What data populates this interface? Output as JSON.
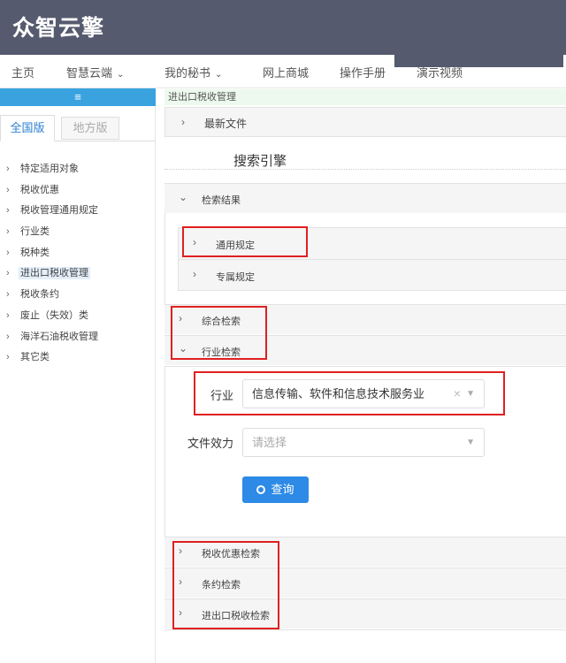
{
  "header": {
    "logo": "众智云擎"
  },
  "nav": {
    "items": [
      {
        "label": "主页",
        "has_caret": false
      },
      {
        "label": "智慧云端",
        "has_caret": true
      },
      {
        "label": "我的秘书",
        "has_caret": true
      },
      {
        "label": "网上商城",
        "has_caret": false
      },
      {
        "label": "操作手册",
        "has_caret": false
      },
      {
        "label": "演示视频",
        "has_caret": false
      }
    ],
    "caret": "⌵"
  },
  "sidebar": {
    "toggle_icon": "≡",
    "tabs": {
      "active": "全国版",
      "inactive": "地方版"
    },
    "tree": [
      "特定适用对象",
      "税收优惠",
      "税收管理通用规定",
      "行业类",
      "税种类",
      "进出口税收管理",
      "税收条约",
      "废止（失效）类",
      "海洋石油税收管理",
      "其它类"
    ],
    "selected_index": 5,
    "chevron": "›"
  },
  "main": {
    "breadcrumb": "进出口税收管理",
    "latest_files": "最新文件",
    "search_title": "搜索引擎",
    "results": {
      "label": "检索结果",
      "items": [
        "通用规定",
        "专属规定"
      ]
    },
    "comprehensive": "综合检索",
    "industry": {
      "label": "行业检索",
      "industry_label": "行业",
      "industry_value": "信息传输、软件和信息技术服务业",
      "file_effect_label": "文件效力",
      "file_effect_placeholder": "请选择",
      "query_button": "查询",
      "clear_icon": "×",
      "arrow_icon": "▼"
    },
    "bottom_sections": [
      "税收优惠检索",
      "条约检索",
      "进出口税收检索"
    ],
    "chevron_right": "›",
    "chevron_down": "⌄"
  },
  "colors": {
    "header_bg": "#555a6e",
    "accent_blue": "#2d8ae6",
    "sidebar_toggle": "#3aa3df",
    "highlight_red": "#e02020",
    "breadcrumb_bg": "#edf9ee"
  }
}
